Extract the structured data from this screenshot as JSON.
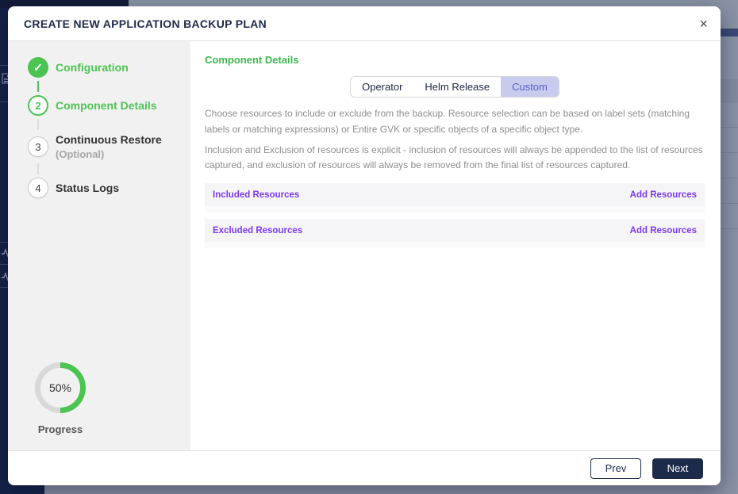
{
  "modal": {
    "title": "CREATE NEW APPLICATION BACKUP PLAN",
    "close_icon": "×",
    "stepper": {
      "check_icon": "✓",
      "steps": [
        {
          "number": "1",
          "label": "Configuration",
          "state": "complete"
        },
        {
          "number": "2",
          "label": "Component Details",
          "state": "active"
        },
        {
          "number": "3",
          "label": "Continuous Restore",
          "sublabel": "(Optional)",
          "state": "upcoming"
        },
        {
          "number": "4",
          "label": "Status Logs",
          "state": "upcoming"
        }
      ],
      "progress": {
        "percent_text": "50%",
        "percent_value": 50,
        "label": "Progress"
      }
    },
    "content": {
      "heading": "Component Details",
      "tabs": [
        {
          "label": "Operator",
          "selected": false
        },
        {
          "label": "Helm Release",
          "selected": false
        },
        {
          "label": "Custom",
          "selected": true
        }
      ],
      "description_paragraphs": [
        "Choose resources to include or exclude from the backup. Resource selection can be based on label sets (matching labels or matching expressions) or Entire GVK or specific objects of a specific object type.",
        "Inclusion and Exclusion of resources is explicit - inclusion of resources will always be appended to the list of resources captured, and exclusion of resources will always be removed from the final list of resources captured."
      ],
      "sections": [
        {
          "label": "Included Resources",
          "action_label": "Add Resources"
        },
        {
          "label": "Excluded Resources",
          "action_label": "Add Resources"
        }
      ]
    },
    "footer": {
      "prev_label": "Prev",
      "next_label": "Next"
    }
  },
  "colors": {
    "green": "#4cc452",
    "navy": "#1c2b4a",
    "purple": "#7c3aed",
    "tab_selected_bg": "#c9cbee",
    "tab_selected_text": "#5a5ec8",
    "overlay_background": "#8b93a7"
  }
}
